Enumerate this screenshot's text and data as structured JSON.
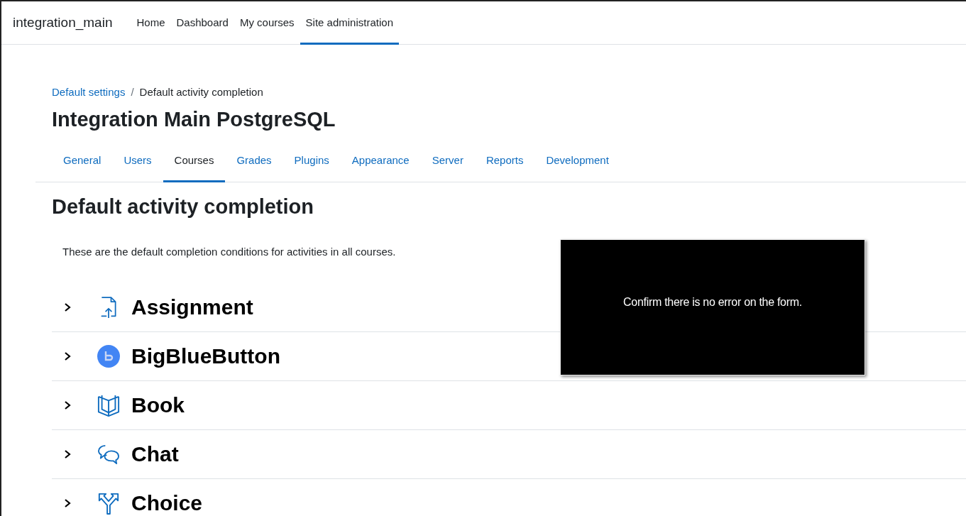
{
  "navbar": {
    "brand": "integration_main",
    "items": [
      {
        "label": "Home",
        "selected": false
      },
      {
        "label": "Dashboard",
        "selected": false
      },
      {
        "label": "My courses",
        "selected": false
      },
      {
        "label": "Site administration",
        "selected": true
      }
    ]
  },
  "breadcrumb_separator": "/",
  "breadcrumb": [
    {
      "label": "Default settings",
      "kind": "link"
    },
    {
      "label": "Default activity completion",
      "kind": "current"
    }
  ],
  "page_title": "Integration Main PostgreSQL",
  "tabs": [
    {
      "label": "General",
      "selected": false
    },
    {
      "label": "Users",
      "selected": false
    },
    {
      "label": "Courses",
      "selected": true
    },
    {
      "label": "Grades",
      "selected": false
    },
    {
      "label": "Plugins",
      "selected": false
    },
    {
      "label": "Appearance",
      "selected": false
    },
    {
      "label": "Server",
      "selected": false
    },
    {
      "label": "Reports",
      "selected": false
    },
    {
      "label": "Development",
      "selected": false
    }
  ],
  "heading": "Default activity completion",
  "description": "These are the default completion conditions for activities in all courses.",
  "activities": [
    {
      "name": "Assignment",
      "kind": "assignment",
      "expanded": false
    },
    {
      "name": "BigBlueButton",
      "kind": "bigbluebutton",
      "expanded": false
    },
    {
      "name": "Book",
      "kind": "book",
      "expanded": false
    },
    {
      "name": "Chat",
      "kind": "chat",
      "expanded": false
    },
    {
      "name": "Choice",
      "kind": "choice",
      "expanded": false
    }
  ],
  "overlay": {
    "message": "Confirm there is no error on the form."
  }
}
